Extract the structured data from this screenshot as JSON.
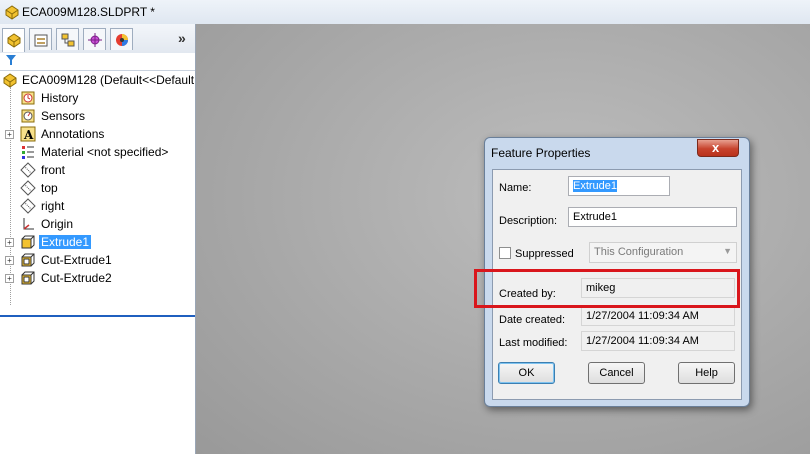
{
  "window": {
    "title": "ECA009M128.SLDPRT *"
  },
  "tabs": [
    {
      "name": "feature-manager-tab",
      "icon": "feature-manager-icon"
    },
    {
      "name": "property-manager-tab",
      "icon": "property-manager-icon"
    },
    {
      "name": "configuration-manager-tab",
      "icon": "configuration-manager-icon"
    },
    {
      "name": "dimxpert-manager-tab",
      "icon": "dimxpert-icon"
    },
    {
      "name": "display-manager-tab",
      "icon": "display-manager-icon"
    }
  ],
  "tabs_more": "»",
  "tree": {
    "root": "ECA009M128  (Default<<Default",
    "items": [
      {
        "label": "History",
        "icon": "history-icon",
        "expandable": false
      },
      {
        "label": "Sensors",
        "icon": "sensors-icon",
        "expandable": false
      },
      {
        "label": "Annotations",
        "icon": "annotations-icon",
        "expandable": true
      },
      {
        "label": "Material <not specified>",
        "icon": "material-icon",
        "expandable": false
      },
      {
        "label": "front",
        "icon": "plane-icon",
        "expandable": false
      },
      {
        "label": "top",
        "icon": "plane-icon",
        "expandable": false
      },
      {
        "label": "right",
        "icon": "plane-icon",
        "expandable": false
      },
      {
        "label": "Origin",
        "icon": "origin-icon",
        "expandable": false
      },
      {
        "label": "Extrude1",
        "icon": "extrude-icon",
        "expandable": true,
        "selected": true
      },
      {
        "label": "Cut-Extrude1",
        "icon": "cut-extrude-icon",
        "expandable": true
      },
      {
        "label": "Cut-Extrude2",
        "icon": "cut-extrude-icon",
        "expandable": true
      }
    ]
  },
  "dialog": {
    "title": "Feature Properties",
    "close_label": "x",
    "name_label": "Name:",
    "name_value": "Extrude1",
    "description_label": "Description:",
    "description_value": "Extrude1",
    "suppressed_label": "Suppressed",
    "suppressed_checked": false,
    "configuration_value": "This Configuration",
    "created_by_label": "Created by:",
    "created_by_value": "mikeg",
    "date_created_label": "Date created:",
    "date_created_value": "1/27/2004 11:09:34 AM",
    "last_modified_label": "Last modified:",
    "last_modified_value": "1/27/2004 11:09:34 AM",
    "ok_label": "OK",
    "cancel_label": "Cancel",
    "help_label": "Help"
  },
  "colors": {
    "selection": "#3399ff",
    "highlight_box": "#d9161c",
    "dialog_frame": "#c9d9ed"
  }
}
